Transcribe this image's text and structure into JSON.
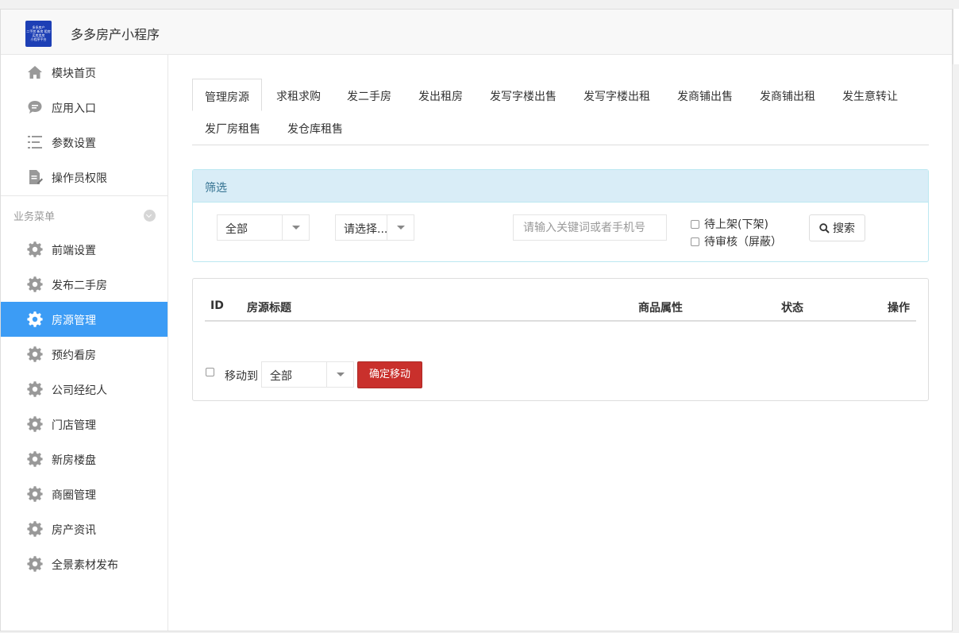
{
  "app": {
    "title": "多多房产小程序",
    "logo_lines": [
      "多多房产",
      "二手房 新房 租房",
      "买房卖房",
      "小程序平台"
    ]
  },
  "sidebar": {
    "top_items": [
      {
        "label": "模块首页",
        "icon": "home-icon"
      },
      {
        "label": "应用入口",
        "icon": "chat-bubble-icon"
      },
      {
        "label": "参数设置",
        "icon": "list-icon"
      },
      {
        "label": "操作员权限",
        "icon": "document-edit-icon"
      }
    ],
    "section_title": "业务菜单",
    "business_items": [
      {
        "label": "前端设置",
        "icon": "gear-icon"
      },
      {
        "label": "发布二手房",
        "icon": "gear-icon"
      },
      {
        "label": "房源管理",
        "icon": "gear-icon",
        "active": true
      },
      {
        "label": "预约看房",
        "icon": "gear-icon"
      },
      {
        "label": "公司经纪人",
        "icon": "gear-icon"
      },
      {
        "label": "门店管理",
        "icon": "gear-icon"
      },
      {
        "label": "新房楼盘",
        "icon": "gear-icon"
      },
      {
        "label": "商圈管理",
        "icon": "gear-icon"
      },
      {
        "label": "房产资讯",
        "icon": "gear-icon"
      },
      {
        "label": "全景素材发布",
        "icon": "gear-icon"
      }
    ]
  },
  "tabs": [
    {
      "label": "管理房源",
      "active": true
    },
    {
      "label": "求租求购"
    },
    {
      "label": "发二手房"
    },
    {
      "label": "发出租房"
    },
    {
      "label": "发写字楼出售"
    },
    {
      "label": "发写字楼出租"
    },
    {
      "label": "发商铺出售"
    },
    {
      "label": "发商铺出租"
    },
    {
      "label": "发生意转让"
    },
    {
      "label": "发厂房租售"
    },
    {
      "label": "发仓库租售"
    }
  ],
  "filter": {
    "title": "筛选",
    "select1_value": "全部",
    "select2_value": "请选择...",
    "keyword_placeholder": "请输入关键词或者手机号",
    "check1_label": "待上架(下架)",
    "check2_label": "待审核（屏蔽）",
    "search_label": "搜索"
  },
  "table": {
    "col_id": "ID",
    "col_title": "房源标题",
    "col_attr": "商品属性",
    "col_status": "状态",
    "col_action": "操作"
  },
  "bulk": {
    "move_label": "移动到",
    "move_select_value": "全部",
    "confirm_label": "确定移动"
  },
  "colors": {
    "active_nav": "#3c9cf5",
    "confirm_button": "#c9302c",
    "filter_header": "#d9edf7",
    "logo_bg": "#1d3fb5"
  }
}
